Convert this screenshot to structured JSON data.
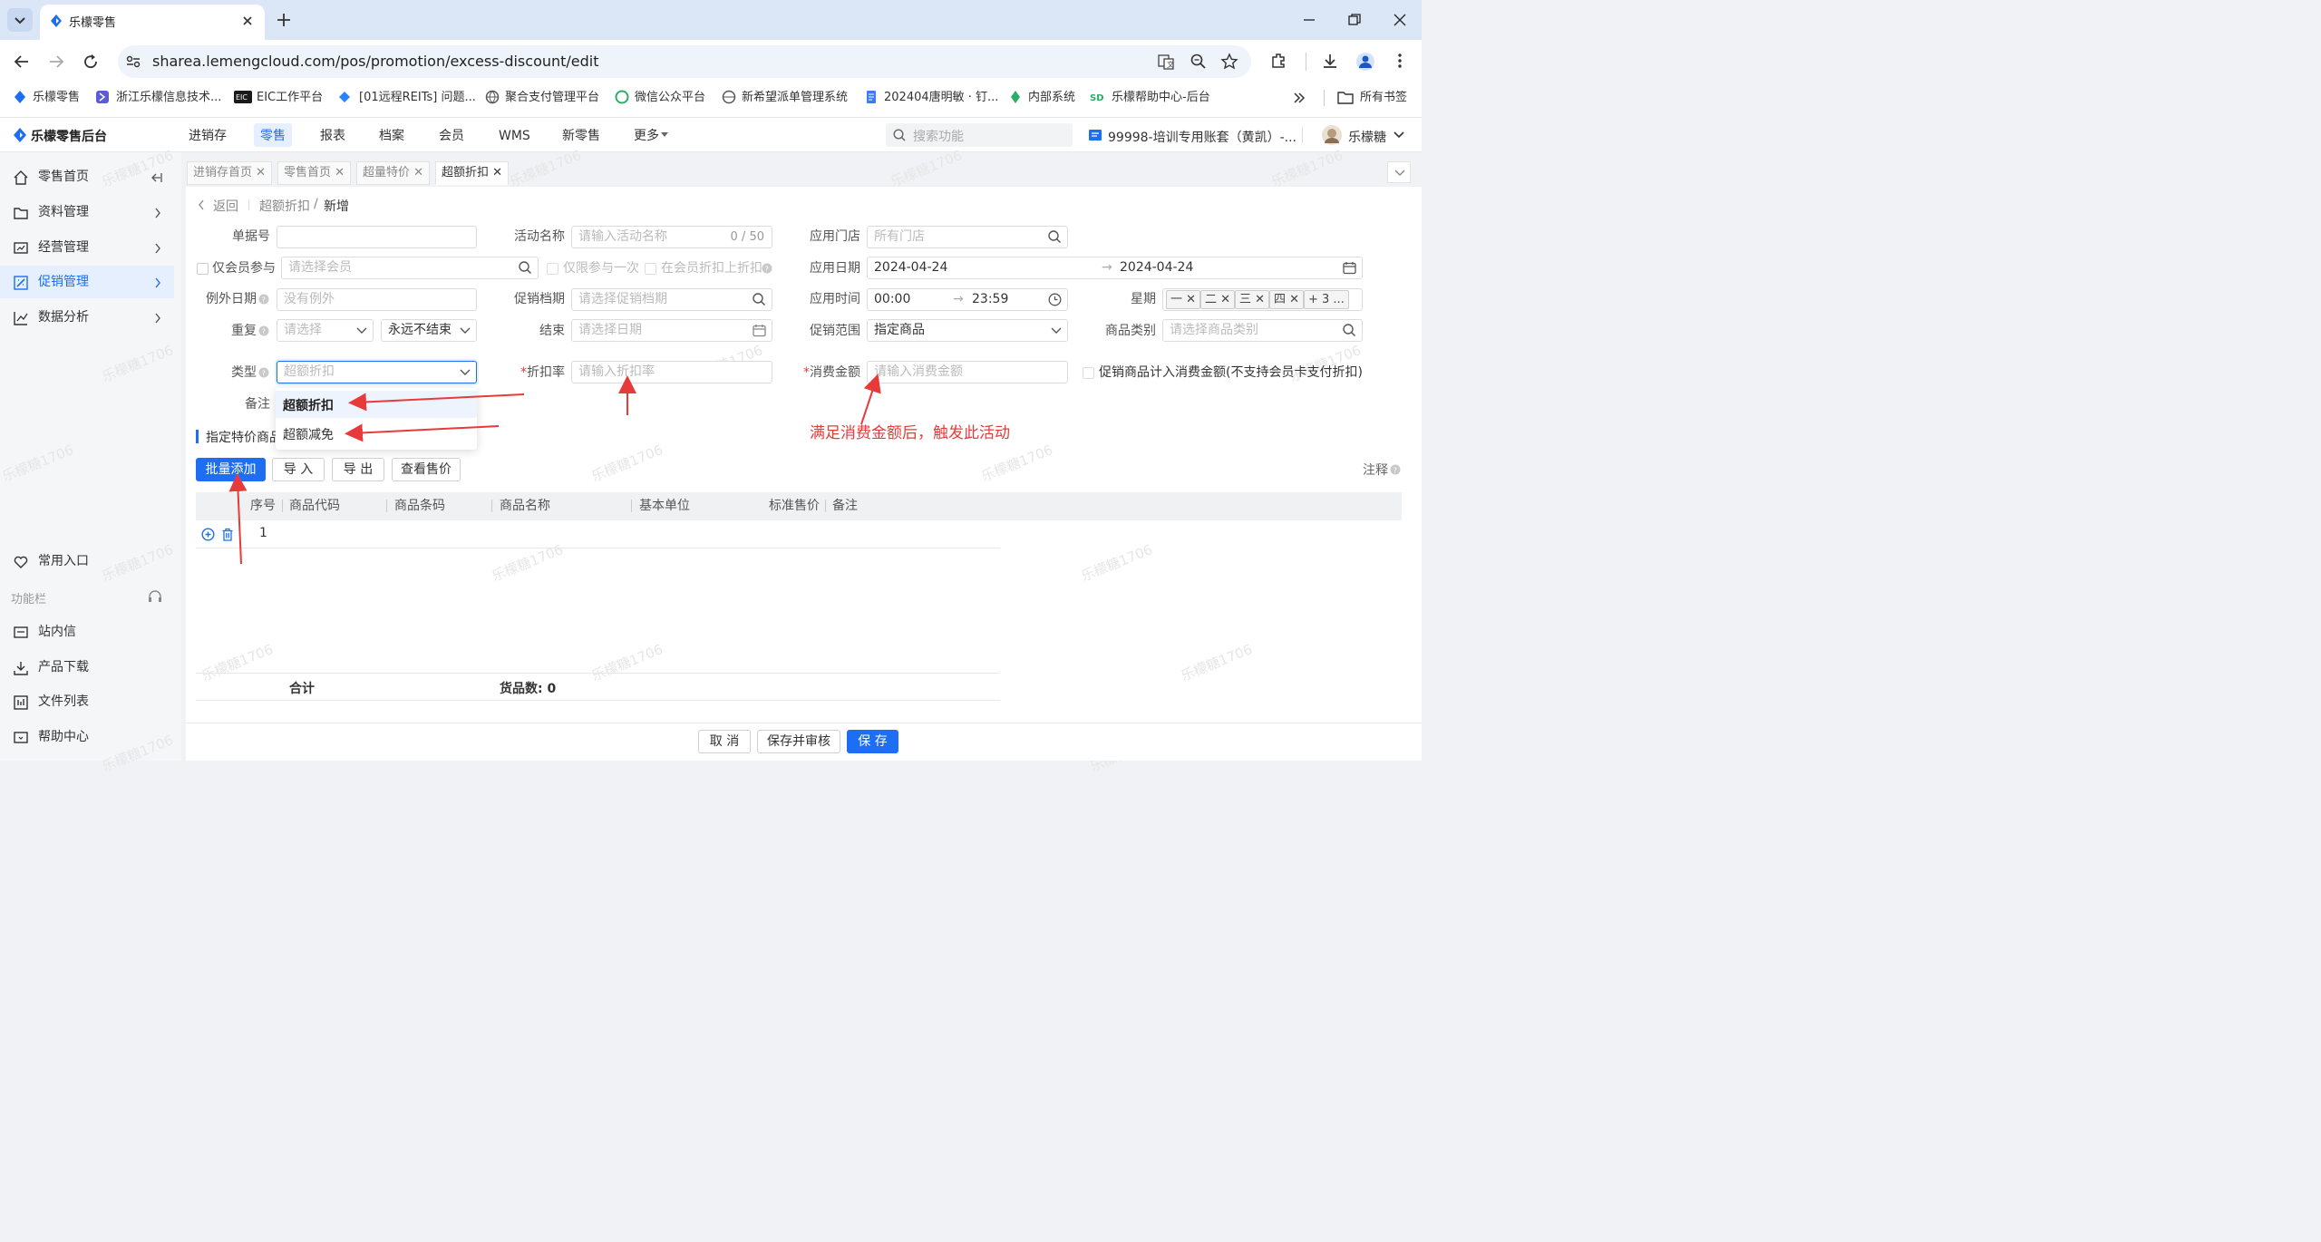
{
  "browser": {
    "tab_title": "乐檬零售",
    "url": "sharea.lemengcloud.com/pos/promotion/excess-discount/edit",
    "bookmarks": [
      "乐檬零售",
      "浙江乐檬信息技术...",
      "EIC工作平台",
      "[01远程REITs] 问题...",
      "聚合支付管理平台",
      "微信公众平台",
      "新希望派单管理系统",
      "202404唐明敏 · 钉...",
      "内部系统",
      "乐檬帮助中心-后台"
    ],
    "all_bookmarks": "所有书签"
  },
  "app": {
    "logo": "乐檬零售后台",
    "nav": [
      "进销存",
      "零售",
      "报表",
      "档案",
      "会员",
      "WMS",
      "新零售",
      "更多"
    ],
    "active_nav": "零售",
    "search_placeholder": "搜索功能",
    "account": "99998-培训专用账套（黄凯）-...",
    "user": "乐檬糖"
  },
  "sidebar": {
    "items": [
      "零售首页",
      "资料管理",
      "经营管理",
      "促销管理",
      "数据分析"
    ],
    "active": "促销管理",
    "common": "常用入口",
    "func_bar": "功能栏",
    "tools": [
      "站内信",
      "产品下载",
      "文件列表",
      "帮助中心"
    ]
  },
  "page_tabs": [
    "进销存首页",
    "零售首页",
    "超量特价",
    "超额折扣"
  ],
  "breadcrumb": {
    "back": "返回",
    "parent": "超额折扣",
    "current": "新增"
  },
  "form": {
    "doc_no": {
      "label": "单据号",
      "value": ""
    },
    "activity_name": {
      "label": "活动名称",
      "placeholder": "请输入活动名称",
      "counter": "0 / 50"
    },
    "store": {
      "label": "应用门店",
      "placeholder": "所有门店"
    },
    "member_only": {
      "label": "仅会员参与",
      "placeholder": "请选择会员"
    },
    "once_only": "仅限参与一次",
    "member_discount": "在会员折扣上折扣",
    "apply_date": {
      "label": "应用日期",
      "start": "2024-04-24",
      "end": "2024-04-24"
    },
    "except_date": {
      "label": "例外日期",
      "placeholder": "没有例外"
    },
    "promo_period": {
      "label": "促销档期",
      "placeholder": "请选择促销档期"
    },
    "apply_time": {
      "label": "应用时间",
      "start": "00:00",
      "end": "23:59"
    },
    "weekday": {
      "label": "星期",
      "chips": [
        "一",
        "二",
        "三",
        "四"
      ],
      "more": "+ 3 ..."
    },
    "repeat": {
      "label": "重复",
      "placeholder": "请选择",
      "end_mode": "永远不结束"
    },
    "end": {
      "label": "结束",
      "placeholder": "请选择日期"
    },
    "scope": {
      "label": "促销范围",
      "value": "指定商品"
    },
    "category": {
      "label": "商品类别",
      "placeholder": "请选择商品类别"
    },
    "type": {
      "label": "类型",
      "placeholder": "超额折扣",
      "options": [
        "超额折扣",
        "超额减免"
      ]
    },
    "discount_rate": {
      "label": "折扣率",
      "placeholder": "请输入折扣率"
    },
    "spend_amount": {
      "label": "消费金额",
      "placeholder": "请输入消费金额"
    },
    "include_promo": "促销商品计入消费金额(不支持会员卡支付折扣)",
    "remark": {
      "label": "备注"
    }
  },
  "section_title": "指定特价商品",
  "toolbar": {
    "batch_add": "批量添加",
    "import": "导 入",
    "export": "导 出",
    "view_price": "查看售价",
    "note": "注释"
  },
  "table": {
    "columns": [
      "序号",
      "商品代码",
      "商品条码",
      "商品名称",
      "基本单位",
      "标准售价",
      "备注"
    ],
    "rows": [
      {
        "index": "1"
      }
    ],
    "footer": {
      "total": "合计",
      "count": "货品数: 0"
    }
  },
  "annotation": "满足消费金额后，触发此活动",
  "footer_buttons": {
    "cancel": "取 消",
    "save_review": "保存并审核",
    "save": "保 存"
  },
  "watermark": "乐檬糖1706",
  "colors": {
    "primary": "#1d6ef2",
    "annotation_red": "#e83a3a",
    "active_bg": "#e6effd"
  }
}
